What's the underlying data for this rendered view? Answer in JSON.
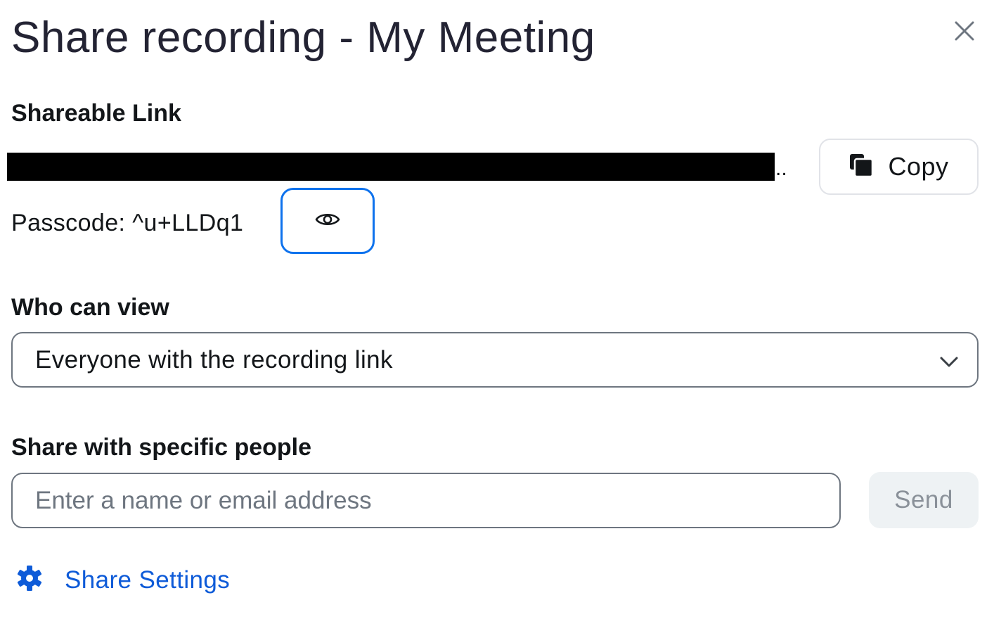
{
  "dialog": {
    "title": "Share recording - My Meeting",
    "close_icon": "close-icon"
  },
  "shareable_link": {
    "label": "Shareable Link",
    "link_trailing_text": "..",
    "copy_label": "Copy",
    "copy_icon": "copy-icon",
    "passcode_text": "Passcode: ^u+LLDq1",
    "eye_icon": "eye-icon"
  },
  "who_can_view": {
    "label": "Who can view",
    "selected": "Everyone with the recording link",
    "chevron_icon": "chevron-down-icon"
  },
  "share_people": {
    "label": "Share with specific people",
    "input_placeholder": "Enter a name or email address",
    "input_value": "",
    "send_label": "Send"
  },
  "settings": {
    "label": "Share Settings",
    "icon": "gear-icon"
  },
  "colors": {
    "accent": "#0e72ed",
    "link": "#0e5bd8",
    "title_text": "#232333",
    "border": "#6e7680",
    "send_bg": "#eef2f4"
  }
}
